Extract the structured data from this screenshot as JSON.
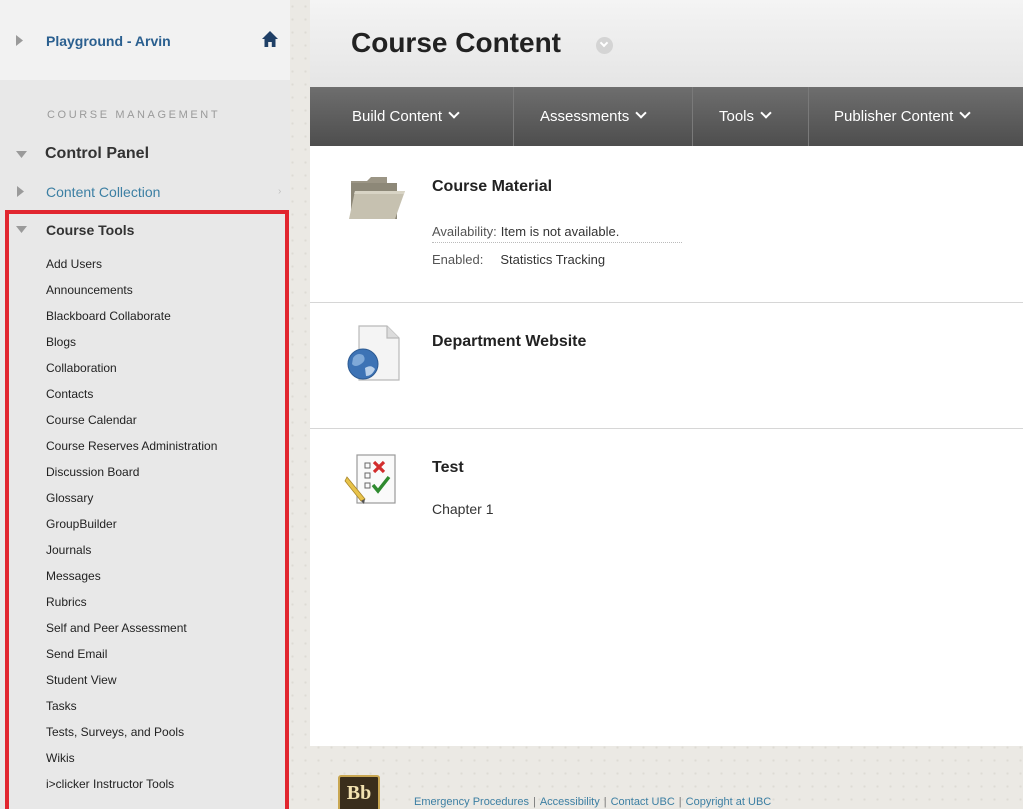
{
  "sidebar": {
    "course_name": "Playground - Arvin",
    "section_label": "COURSE MANAGEMENT",
    "control_panel": "Control Panel",
    "content_collection": "Content Collection",
    "course_tools": "Course Tools",
    "tools": [
      "Add Users",
      "Announcements",
      "Blackboard Collaborate",
      "Blogs",
      "Collaboration",
      "Contacts",
      "Course Calendar",
      "Course Reserves Administration",
      "Discussion Board",
      "Glossary",
      "GroupBuilder",
      "Journals",
      "Messages",
      "Rubrics",
      "Self and Peer Assessment",
      "Send Email",
      "Student View",
      "Tasks",
      "Tests, Surveys, and Pools",
      "Wikis",
      "i>clicker Instructor Tools"
    ]
  },
  "main": {
    "title": "Course Content",
    "action_bar": [
      "Build Content",
      "Assessments",
      "Tools",
      "Publisher Content"
    ],
    "items": [
      {
        "title": "Course Material",
        "availability_label": "Availability:",
        "availability_value": "Item is not available.",
        "enabled_label": "Enabled:",
        "enabled_value": "Statistics Tracking",
        "icon": "folder-icon"
      },
      {
        "title": "Department Website",
        "icon": "web-link-icon"
      },
      {
        "title": "Test",
        "subtitle": "Chapter 1",
        "icon": "test-icon"
      }
    ]
  },
  "footer": {
    "logo": "Bb",
    "links": [
      "Emergency Procedures",
      "Accessibility",
      "Contact UBC",
      "Copyright at UBC"
    ]
  },
  "colors": {
    "highlight_box": "#e1262f",
    "link": "#2a5f8f",
    "action_bar": "#5a5a5a"
  }
}
